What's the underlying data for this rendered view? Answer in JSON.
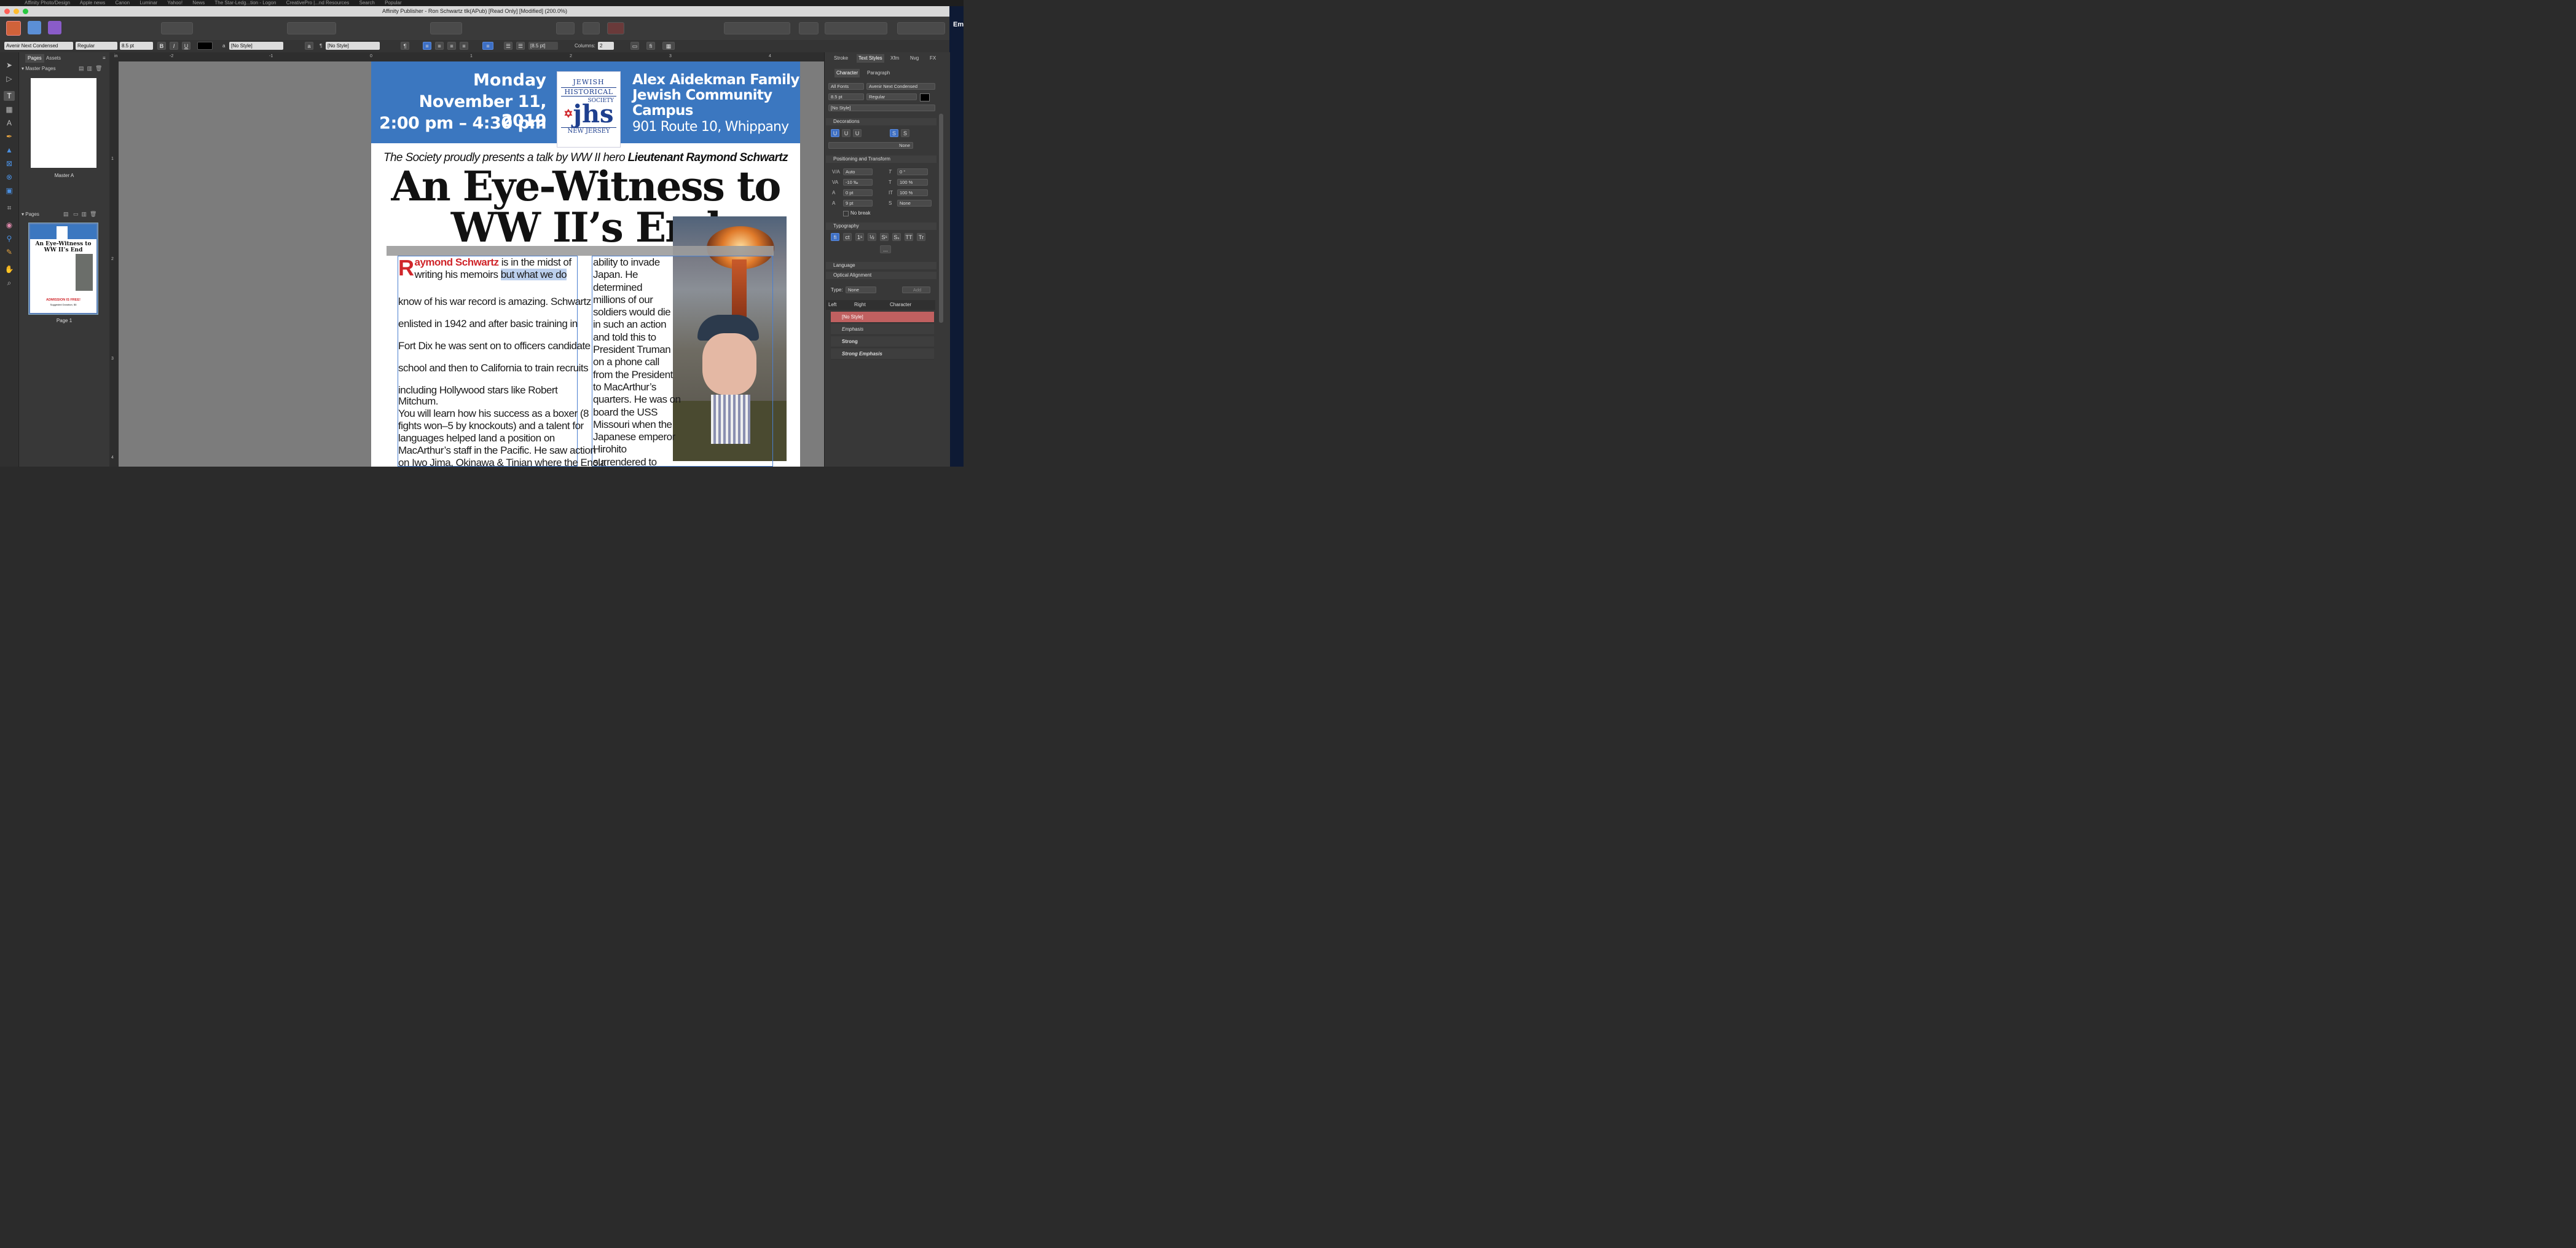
{
  "bookmarks": [
    "Affinity Photo/Design",
    "Apple news",
    "Canon",
    "Luminar",
    "Yahoo!",
    "News",
    "The Star-Ledg...tion - Logon",
    "CreativePro |...nd Resources",
    "Search",
    "Popular"
  ],
  "window_title": "Affinity Publisher - Ron Schwartz tlk(APub) [Read Only] [Modified] (200.0%)",
  "desktop_text": "Em",
  "context_toolbar": {
    "font_family": "Avenir Next Condensed",
    "font_style": "Regular",
    "font_size": "8.5 pt",
    "bold": "B",
    "italic": "I",
    "underline": "U",
    "char_style": "[No Style]",
    "para_style": "[No Style]",
    "leading": "[8.5 pt]",
    "columns_label": "Columns:",
    "columns_value": "2",
    "pilcrow": "¶",
    "a_glyph": "a"
  },
  "pages_panel": {
    "tabs": [
      "Pages",
      "Assets"
    ],
    "master_pages_label": "Master Pages",
    "master_name": "Master A",
    "pages_label": "Pages",
    "page_name": "Page 1"
  },
  "ruler": {
    "h_unit": "in",
    "h_ticks": [
      "-2",
      "-1",
      "0",
      "1",
      "2",
      "3",
      "4"
    ],
    "v_ticks": [
      "1",
      "2",
      "3",
      "4"
    ]
  },
  "document": {
    "date_line1": "Monday",
    "date_line2": "November 11, 2019",
    "date_line3": "2:00 pm – 4:30 pm",
    "logo_jewish": "JEWISH",
    "logo_historical": "HISTORICAL",
    "logo_society": "SOCIETY",
    "logo_jhs": "jhs",
    "logo_nj": "NEW JERSEY",
    "venue_line1": "Alex Aidekman Family",
    "venue_line2": "Jewish Community",
    "venue_line3": "Campus",
    "venue_line4": "901 Route 10, Whippany",
    "tagline_pre": "The Society proudly presents a talk by WW II hero ",
    "tagline_name": "Lieutenant Raymond Schwartz",
    "headline_1": "An Eye-Witness to",
    "headline_2": "WW II’s End",
    "dropcap": "R",
    "lead_name": "aymond Schwartz",
    "col1_line1_rest": " is in the midst of",
    "col1_line2a": "writing his memoirs ",
    "col1_line2b": " but what we do",
    "col1_lines": [
      "know of his war record is amazing. Schwartz",
      "enlisted in 1942 and after basic training in",
      "Fort Dix he was sent on to officers candidate",
      "school and then to California to train recruits",
      "including Hollywood stars like Robert"
    ],
    "col1_tight": [
      "Mitchum.",
      "   You will learn how his success as a boxer (8",
      "fights won–5 by knockouts) and a talent for",
      "languages helped land a position on",
      "MacArthur’s staff in the Pacific.  He saw action",
      "on Iwo Jima, Okinawa & Tinian where the Enola"
    ],
    "col2_lines": [
      "ability to invade",
      "Japan. He",
      "determined",
      "millions of our",
      "soldiers would die",
      "in such an action",
      "and told this to",
      "President Truman",
      "on a phone call",
      "from the President",
      "to MacArthur’s",
      "quarters. He was on",
      "board the USS",
      "Missouri when the",
      "Japanese emperor",
      "Hirohito",
      "surrendered to"
    ]
  },
  "thumb": {
    "admission": "ADMISSION IS FREE!",
    "donation": "Suggested Donation, $5"
  },
  "right_panel": {
    "tabs": [
      "Stroke",
      "Text Styles",
      "Xfm",
      "Nvg",
      "FX"
    ],
    "subtabs": [
      "Character",
      "Paragraph"
    ],
    "font_collection": "All Fonts",
    "font_family": "Avenir Next Condensed",
    "font_size": "8.5 pt",
    "font_style": "Regular",
    "char_style": "[No Style]",
    "decorations_label": "Decorations",
    "decoration_none": "None",
    "positioning_label": "Positioning and Transform",
    "kerning": "Auto",
    "tracking": "-10 ‰",
    "baseline": "0 pt",
    "leading": "9 pt",
    "shear": "0 °",
    "scale_h": "100 %",
    "scale_v": "100 %",
    "case": "None",
    "no_break": "No break",
    "typography_label": "Typography",
    "typography_more": "...",
    "language_label": "Language",
    "optical_label": "Optical Alignment",
    "type_label": "Type:",
    "type_value": "None",
    "add_label": "Add",
    "columns": [
      "Left",
      "Right",
      "Character"
    ],
    "styles": [
      "[No Style]",
      "Emphasis",
      "Strong",
      "Strong Emphasis"
    ]
  },
  "colors": {
    "banner_blue": "#3b77c0",
    "dropcap_red": "#d0262b",
    "selection_blue": "#bcd0ee",
    "accent_blue": "#3d6fc4"
  }
}
